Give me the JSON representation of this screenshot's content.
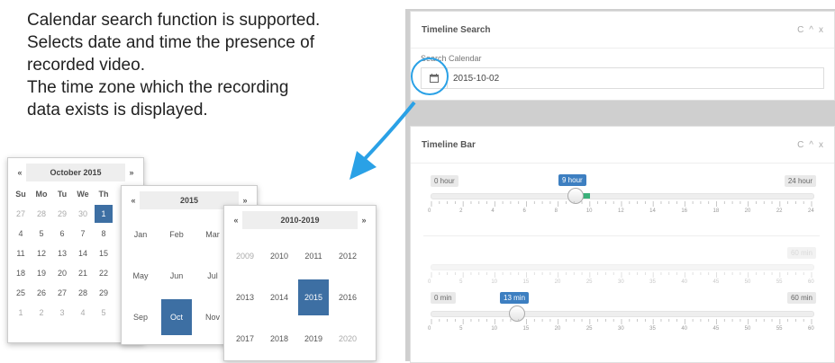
{
  "intro": {
    "line1": "Calendar search function is supported.",
    "line2": "Selects date and time the presence of",
    "line3": "recorded video.",
    "line4": "The time zone which the recording",
    "line5": "data exists is displayed."
  },
  "timeline_search": {
    "title": "Timeline Search",
    "label": "Search Calendar",
    "value": "2015-10-02",
    "calendar_icon": "calendar-icon"
  },
  "timeline_bar": {
    "title": "Timeline Bar",
    "hour_min": "0 hour",
    "hour_value": "9 hour",
    "hour_max": "24 hour",
    "hour_ticks": [
      "0",
      "2",
      "4",
      "6",
      "8",
      "10",
      "12",
      "14",
      "16",
      "18",
      "20",
      "22",
      "24"
    ],
    "min_max_faded": "60 min",
    "min_ticks_faded": [
      "0",
      "5",
      "10",
      "15",
      "20",
      "25",
      "30",
      "35",
      "40",
      "45",
      "50",
      "55",
      "60"
    ],
    "min_min": "0 min",
    "min_value": "13 min",
    "min_max": "60 min",
    "min_ticks": [
      "0",
      "5",
      "10",
      "15",
      "20",
      "25",
      "30",
      "35",
      "40",
      "45",
      "50",
      "55",
      "60"
    ]
  },
  "panel_controls": {
    "refresh": "C",
    "collapse": "^",
    "close": "x"
  },
  "cal_days": {
    "prev": "«",
    "next": "»",
    "title": "October 2015",
    "weekdays": [
      "Su",
      "Mo",
      "Tu",
      "We",
      "Th"
    ],
    "rows": [
      [
        "27",
        "28",
        "29",
        "30",
        "1"
      ],
      [
        "4",
        "5",
        "6",
        "7",
        "8"
      ],
      [
        "11",
        "12",
        "13",
        "14",
        "15"
      ],
      [
        "18",
        "19",
        "20",
        "21",
        "22"
      ],
      [
        "25",
        "26",
        "27",
        "28",
        "29"
      ],
      [
        "1",
        "2",
        "3",
        "4",
        "5"
      ]
    ]
  },
  "cal_months": {
    "prev": "«",
    "next": "»",
    "title": "2015",
    "rows": [
      [
        "Jan",
        "Feb",
        "Mar"
      ],
      [
        "May",
        "Jun",
        "Jul"
      ],
      [
        "Sep",
        "Oct",
        "Nov"
      ]
    ]
  },
  "cal_years": {
    "prev": "«",
    "next": "»",
    "title": "2010-2019",
    "rows": [
      [
        "2009",
        "2010",
        "2011",
        "2012"
      ],
      [
        "2013",
        "2014",
        "2015",
        "2016"
      ],
      [
        "2017",
        "2018",
        "2019",
        "2020"
      ]
    ]
  },
  "colors": {
    "accent": "#2aa1e6",
    "selected": "#3d6fa3",
    "label_blue": "#3d7fc1",
    "range_green": "#3bb07a"
  },
  "slider_levels": {
    "hour": 9,
    "hour_range": [
      0,
      24
    ],
    "minute": 13,
    "minute_range": [
      0,
      60
    ]
  }
}
